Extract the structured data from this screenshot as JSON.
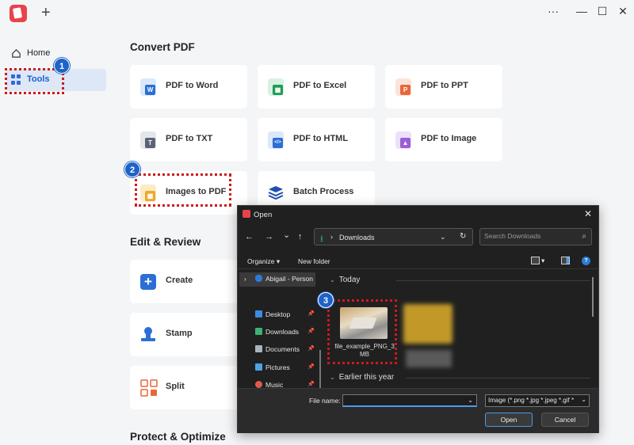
{
  "titlebar": {
    "new_tab": "+",
    "more": "···",
    "minimize": "—",
    "maximize": "☐",
    "close": "✕"
  },
  "sidebar": {
    "items": [
      {
        "label": "Home",
        "icon": "home-icon"
      },
      {
        "label": "Tools",
        "icon": "grid-icon",
        "active": true
      }
    ]
  },
  "main": {
    "sections": [
      {
        "title": "Convert PDF"
      },
      {
        "title": "Edit & Review"
      },
      {
        "title": "Protect & Optimize"
      }
    ],
    "convert_cards": [
      {
        "label": "PDF to Word",
        "icon": "word-icon",
        "color": "#2b6fd6",
        "badge": "W"
      },
      {
        "label": "PDF to Excel",
        "icon": "excel-icon",
        "color": "#1f9d55",
        "badge": "▦"
      },
      {
        "label": "PDF to PPT",
        "icon": "ppt-icon",
        "color": "#e8673a",
        "badge": "P"
      },
      {
        "label": "PDF to TXT",
        "icon": "txt-icon",
        "color": "#5a6474",
        "badge": "T"
      },
      {
        "label": "PDF to HTML",
        "icon": "html-icon",
        "color": "#2b6fd6",
        "badge": "</>"
      },
      {
        "label": "PDF to Image",
        "icon": "image-icon",
        "color": "#9a5fd6",
        "badge": "▲"
      },
      {
        "label": "Images to PDF",
        "icon": "images-to-pdf-icon",
        "color": "#f0a72a",
        "badge": "▩"
      },
      {
        "label": "Batch Process",
        "icon": "layers-icon",
        "color": "#1f4fb0",
        "badge": "≡"
      }
    ],
    "edit_cards": [
      {
        "label": "Create",
        "icon": "plus-icon",
        "color": "#2b6fd6"
      },
      {
        "label": "Stamp",
        "icon": "stamp-icon",
        "color": "#2b6fd6"
      },
      {
        "label": "Split",
        "icon": "split-icon",
        "color": "#e8673a"
      }
    ]
  },
  "steps": [
    "1",
    "2",
    "3"
  ],
  "dialog": {
    "title": "Open",
    "close": "✕",
    "nav": {
      "back": "←",
      "forward": "→",
      "recent": "⌄",
      "up": "↑"
    },
    "address": {
      "folder": "Downloads"
    },
    "search": {
      "placeholder": "Search Downloads"
    },
    "commands": {
      "organize": "Organize ▾",
      "new_folder": "New folder"
    },
    "navpane": [
      {
        "label": "Abigail - Person",
        "icon": "onedrive-icon"
      },
      {
        "label": "Desktop",
        "icon": "desktop-icon",
        "pinned": true
      },
      {
        "label": "Downloads",
        "icon": "downloads-icon",
        "pinned": true
      },
      {
        "label": "Documents",
        "icon": "documents-icon",
        "pinned": true
      },
      {
        "label": "Pictures",
        "icon": "pictures-icon",
        "pinned": true
      },
      {
        "label": "Music",
        "icon": "music-icon",
        "pinned": true
      }
    ],
    "groups": [
      {
        "label": "Today"
      },
      {
        "label": "Earlier this year"
      }
    ],
    "files": [
      {
        "name": "file_example_PNG_3MB"
      }
    ],
    "footer": {
      "file_name_label": "File name:",
      "file_name_value": "",
      "file_type": "Image (*.png *.jpg *.jpeg *.gif *",
      "open": "Open",
      "cancel": "Cancel"
    }
  }
}
